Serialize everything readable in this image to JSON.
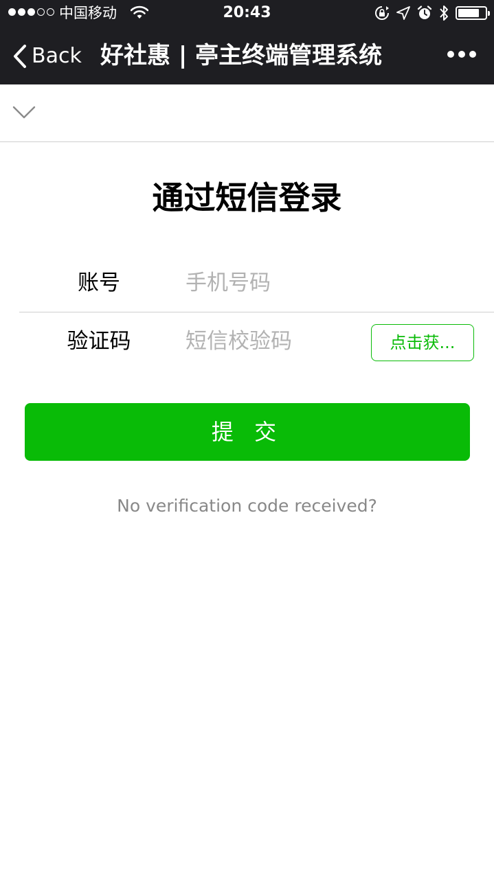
{
  "status_bar": {
    "carrier": "中国移动",
    "time": "20:43",
    "signal_dots_filled": 3,
    "signal_dots_total": 5,
    "battery_level": 0.8,
    "icons": [
      "wifi-icon",
      "rotation-lock-icon",
      "location-icon",
      "alarm-icon",
      "bluetooth-icon",
      "battery-icon"
    ]
  },
  "navbar": {
    "back_label": "Back",
    "title": "好社惠 | 亭主终端管理系统"
  },
  "login": {
    "heading": "通过短信登录",
    "account_label": "账号",
    "account_placeholder": "手机号码",
    "code_label": "验证码",
    "code_placeholder": "短信校验码",
    "get_code_label": "点击获...",
    "submit_label": "提 交",
    "no_code_link": "No verification code received?"
  },
  "colors": {
    "nav_background": "#1e1e22",
    "accent_green": "#09bb07",
    "placeholder_gray": "#b2b2b2",
    "link_gray": "#888888"
  }
}
